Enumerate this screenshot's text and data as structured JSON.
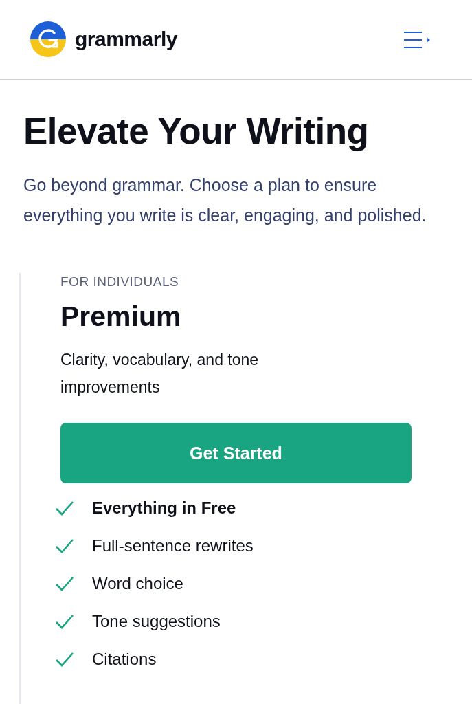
{
  "header": {
    "logo_text": "grammarly"
  },
  "hero": {
    "title": "Elevate Your Writing",
    "subtitle": "Go beyond grammar. Choose a plan to ensure everything you write is clear, engaging, and polished."
  },
  "plan": {
    "eyebrow": "FOR INDIVIDUALS",
    "name": "Premium",
    "description": "Clarity, vocabulary, and tone improvements",
    "button": "Get Started",
    "features": [
      {
        "label": "Everything in Free",
        "bold": true
      },
      {
        "label": "Full-sentence rewrites",
        "bold": false
      },
      {
        "label": "Word choice",
        "bold": false
      },
      {
        "label": "Tone suggestions",
        "bold": false
      },
      {
        "label": "Citations",
        "bold": false
      }
    ]
  }
}
